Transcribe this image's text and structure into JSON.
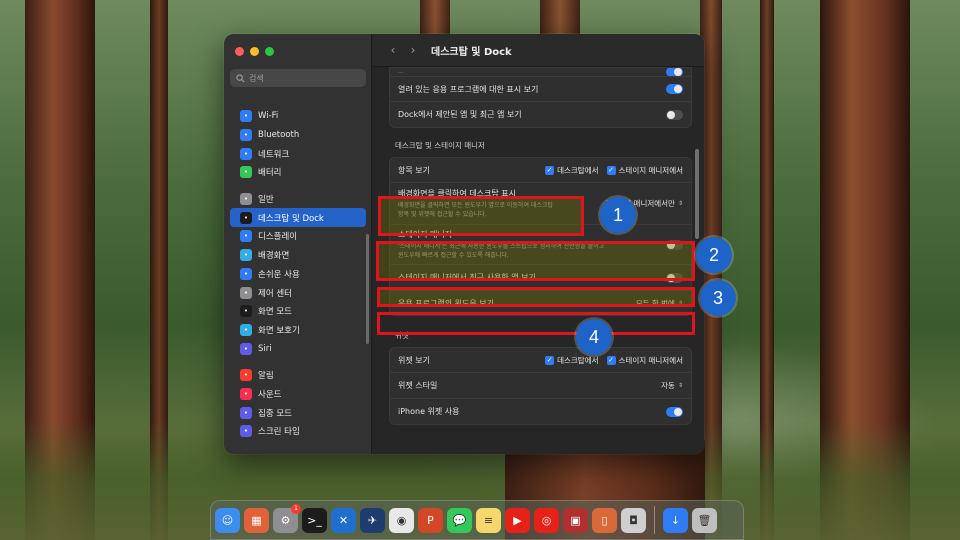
{
  "sidebar": {
    "search_placeholder": "검색",
    "items": [
      {
        "label": "Wi-Fi",
        "icon": "wifi-icon",
        "color": "#2f7cf6"
      },
      {
        "label": "Bluetooth",
        "icon": "bluetooth-icon",
        "color": "#2f7cf6"
      },
      {
        "label": "네트워크",
        "icon": "globe-icon",
        "color": "#2f7cf6"
      },
      {
        "label": "배터리",
        "icon": "battery-icon",
        "color": "#34c759"
      },
      {
        "label": "일반",
        "icon": "gear-icon",
        "color": "#8e8e93"
      },
      {
        "label": "데스크탑 및 Dock",
        "icon": "dock-icon",
        "color": "#1c1c1e",
        "active": true
      },
      {
        "label": "디스플레이",
        "icon": "sun-icon",
        "color": "#2f7cf6"
      },
      {
        "label": "배경화면",
        "icon": "snowflake-icon",
        "color": "#32ade6"
      },
      {
        "label": "손쉬운 사용",
        "icon": "accessibility-icon",
        "color": "#2f7cf6"
      },
      {
        "label": "제어 센터",
        "icon": "control-center-icon",
        "color": "#8e8e93"
      },
      {
        "label": "화면 모드",
        "icon": "appearance-icon",
        "color": "#1c1c1e"
      },
      {
        "label": "화면 보호기",
        "icon": "screensaver-icon",
        "color": "#32ade6"
      },
      {
        "label": "Siri",
        "icon": "siri-icon",
        "color": "#5e5ce6"
      },
      {
        "label": "알림",
        "icon": "bell-icon",
        "color": "#ff3b30"
      },
      {
        "label": "사운드",
        "icon": "speaker-icon",
        "color": "#ff2d55"
      },
      {
        "label": "집중 모드",
        "icon": "moon-icon",
        "color": "#5e5ce6"
      },
      {
        "label": "스크린 타임",
        "icon": "hourglass-icon",
        "color": "#5e5ce6"
      }
    ]
  },
  "header": {
    "title": "데스크탑 및 Dock",
    "back": "‹",
    "forward": "›"
  },
  "top_group": {
    "cut_label": "...",
    "rows": [
      {
        "label": "열려 있는 응용 프로그램에 대한 표시 보기",
        "toggle": "on"
      },
      {
        "label": "Dock에서 제안된 앱 및 최근 앱 보기",
        "toggle": "off"
      }
    ]
  },
  "desktop_section": {
    "title": "데스크탑 및 스테이지 매니저",
    "show_items": {
      "label": "항목 보기",
      "opt1": "데스크탑에서",
      "opt2": "스테이지 매니저에서"
    },
    "click_wallpaper": {
      "label": "배경화면을 클릭하여 데스크탑 표시",
      "desc1": "배경화면을 클릭하면 모든 윈도우가 옆으로 이동하여 데스크탑",
      "desc2": "항목 및 위젯에 접근할 수 있습니다.",
      "value": "스테이지 매니저에서만"
    },
    "stage_manager": {
      "label": "스테이지 매니저",
      "desc1": "'스테이지 매니저'는 최근에 사용한 윈도우를 스트립으로 정리하여 산만함을 줄이고",
      "desc2": "윈도우에 빠르게 접근할 수 있도록 해줍니다.",
      "toggle": "off"
    },
    "recent_apps": {
      "label": "스테이지 매니저에서 최근 사용한 앱 보기",
      "toggle": "off"
    },
    "app_windows": {
      "label": "응용 프로그램의 윈도우 보기",
      "value": "모두 한 번에"
    }
  },
  "widgets_section": {
    "title": "위젯",
    "show_widgets": {
      "label": "위젯 보기",
      "opt1": "데스크탑에서",
      "opt2": "스테이지 매니저에서"
    },
    "style": {
      "label": "위젯 스타일",
      "value": "자동"
    },
    "iphone": {
      "label": "iPhone 위젯 사용",
      "toggle": "on"
    }
  },
  "annotations": [
    "1",
    "2",
    "3",
    "4"
  ],
  "dock": {
    "apps": [
      {
        "name": "finder-icon",
        "color": "#3d8cf0",
        "glyph": "☺"
      },
      {
        "name": "launchpad-icon",
        "color": "#e0623a",
        "glyph": "▦"
      },
      {
        "name": "system-settings-icon",
        "color": "#8e8e93",
        "glyph": "⚙",
        "badge": "1"
      },
      {
        "name": "terminal-icon",
        "color": "#1c1c1c",
        "glyph": ">_"
      },
      {
        "name": "vscode-icon",
        "color": "#1f6fd0",
        "glyph": "✕"
      },
      {
        "name": "bird-app-icon",
        "color": "#1d3d6e",
        "glyph": "✈"
      },
      {
        "name": "chrome-icon",
        "color": "#e8e8e8",
        "glyph": "◉"
      },
      {
        "name": "powerpoint-icon",
        "color": "#d24726",
        "glyph": "P"
      },
      {
        "name": "messages-icon",
        "color": "#34c759",
        "glyph": "💬"
      },
      {
        "name": "notes-icon",
        "color": "#f5d76e",
        "glyph": "≡"
      },
      {
        "name": "youtube-icon",
        "color": "#e62117",
        "glyph": "▶"
      },
      {
        "name": "youtube-music-icon",
        "color": "#e62117",
        "glyph": "◎"
      },
      {
        "name": "photo-app-icon",
        "color": "#b03030",
        "glyph": "▣"
      },
      {
        "name": "iphone-mirroring-icon",
        "color": "#d86a3a",
        "glyph": "▯"
      },
      {
        "name": "screenshot-icon",
        "color": "#cfcfcf",
        "glyph": "◘"
      },
      {
        "name": "downloads-icon",
        "color": "#2e7cf6",
        "glyph": "↓"
      },
      {
        "name": "trash-icon",
        "color": "#bfbfbf",
        "glyph": "🗑"
      }
    ]
  }
}
